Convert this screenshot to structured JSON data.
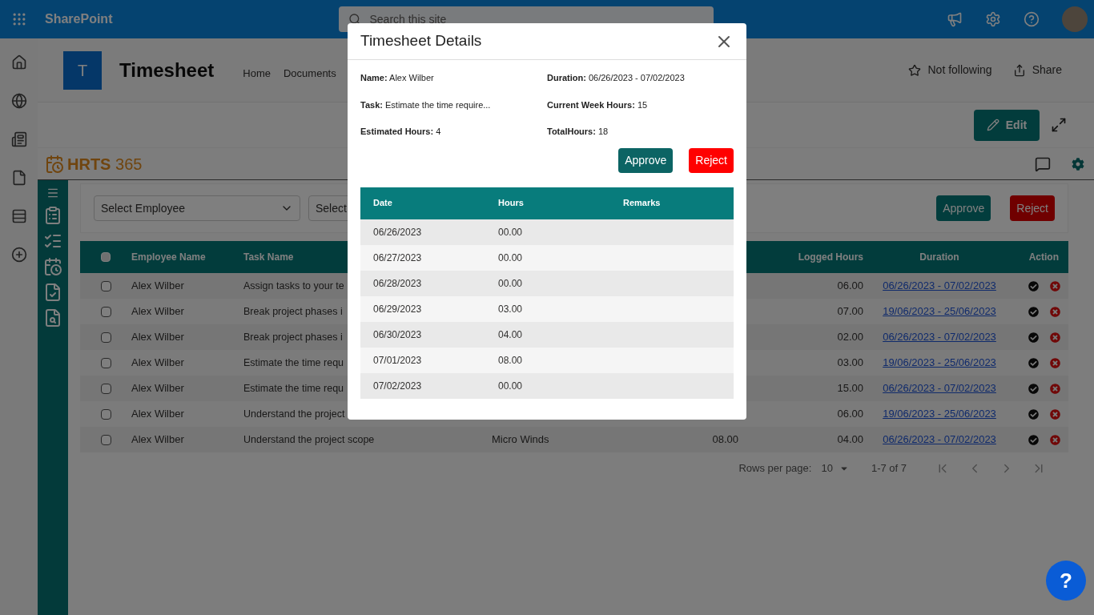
{
  "topbar": {
    "app_name": "SharePoint",
    "search": {
      "placeholder": "Search this site"
    }
  },
  "site": {
    "logo_letter": "T",
    "title": "Timesheet",
    "nav": [
      {
        "label": "Home"
      },
      {
        "label": "Documents"
      }
    ],
    "follow": "Not following",
    "share": "Share",
    "edit": "Edit"
  },
  "app": {
    "logo_bold": "HRTS",
    "logo_number": "365"
  },
  "filters": {
    "employee_select": "Select Employee",
    "second_select": "Select",
    "approve": "Approve",
    "reject": "Reject"
  },
  "table": {
    "header_checked": false,
    "columns": {
      "employee": "Employee Name",
      "task": "Task Name",
      "logged": "Logged Hours",
      "duration": "Duration",
      "action": "Action"
    },
    "rows": [
      {
        "checked": false,
        "employee": "Alex Wilber",
        "task": "Assign tasks to your te",
        "logged": "06.00",
        "duration": "06/26/2023 - 07/02/2023"
      },
      {
        "checked": false,
        "employee": "Alex Wilber",
        "task": "Break project phases i",
        "logged": "07.00",
        "duration": "19/06/2023 - 25/06/2023"
      },
      {
        "checked": false,
        "employee": "Alex Wilber",
        "task": "Break project phases i",
        "logged": "02.00",
        "duration": "06/26/2023 - 07/02/2023"
      },
      {
        "checked": false,
        "employee": "Alex Wilber",
        "task": "Estimate the time requ",
        "logged": "03.00",
        "duration": "19/06/2023 - 25/06/2023"
      },
      {
        "checked": false,
        "employee": "Alex Wilber",
        "task": "Estimate the time requ",
        "logged": "15.00",
        "duration": "06/26/2023 - 07/02/2023"
      },
      {
        "checked": false,
        "employee": "Alex Wilber",
        "task": "Understand the project",
        "logged": "06.00",
        "duration": "19/06/2023 - 25/06/2023"
      },
      {
        "checked": false,
        "employee": "Alex Wilber",
        "task": "Understand the project scope",
        "project": "Micro Winds",
        "estimated": "08.00",
        "logged": "04.00",
        "duration": "06/26/2023 - 07/02/2023"
      }
    ]
  },
  "pagination": {
    "rows_per_page_label": "Rows per page:",
    "rows_per_page": "10",
    "range": "1-7 of 7"
  },
  "help_button": "?",
  "modal": {
    "title": "Timesheet Details",
    "fields": [
      {
        "label": "Name:",
        "value": "Alex Wilber"
      },
      {
        "label": "Duration:",
        "value": "06/26/2023 - 07/02/2023"
      },
      {
        "label": "Task:",
        "value": "Estimate the time require..."
      },
      {
        "label": "Current Week Hours:",
        "value": "15"
      },
      {
        "label": "Estimated Hours:",
        "value": "4"
      },
      {
        "label": "TotalHours:",
        "value": "18"
      }
    ],
    "approve": "Approve",
    "reject": "Reject",
    "columns": [
      "Date",
      "Hours",
      "Remarks"
    ],
    "rows": [
      {
        "date": "06/26/2023",
        "hours": "00.00"
      },
      {
        "date": "06/27/2023",
        "hours": "00.00"
      },
      {
        "date": "06/28/2023",
        "hours": "00.00"
      },
      {
        "date": "06/29/2023",
        "hours": "03.00"
      },
      {
        "date": "06/30/2023",
        "hours": "04.00"
      },
      {
        "date": "07/01/2023",
        "hours": "08.00"
      },
      {
        "date": "07/02/2023",
        "hours": "00.00"
      }
    ]
  }
}
